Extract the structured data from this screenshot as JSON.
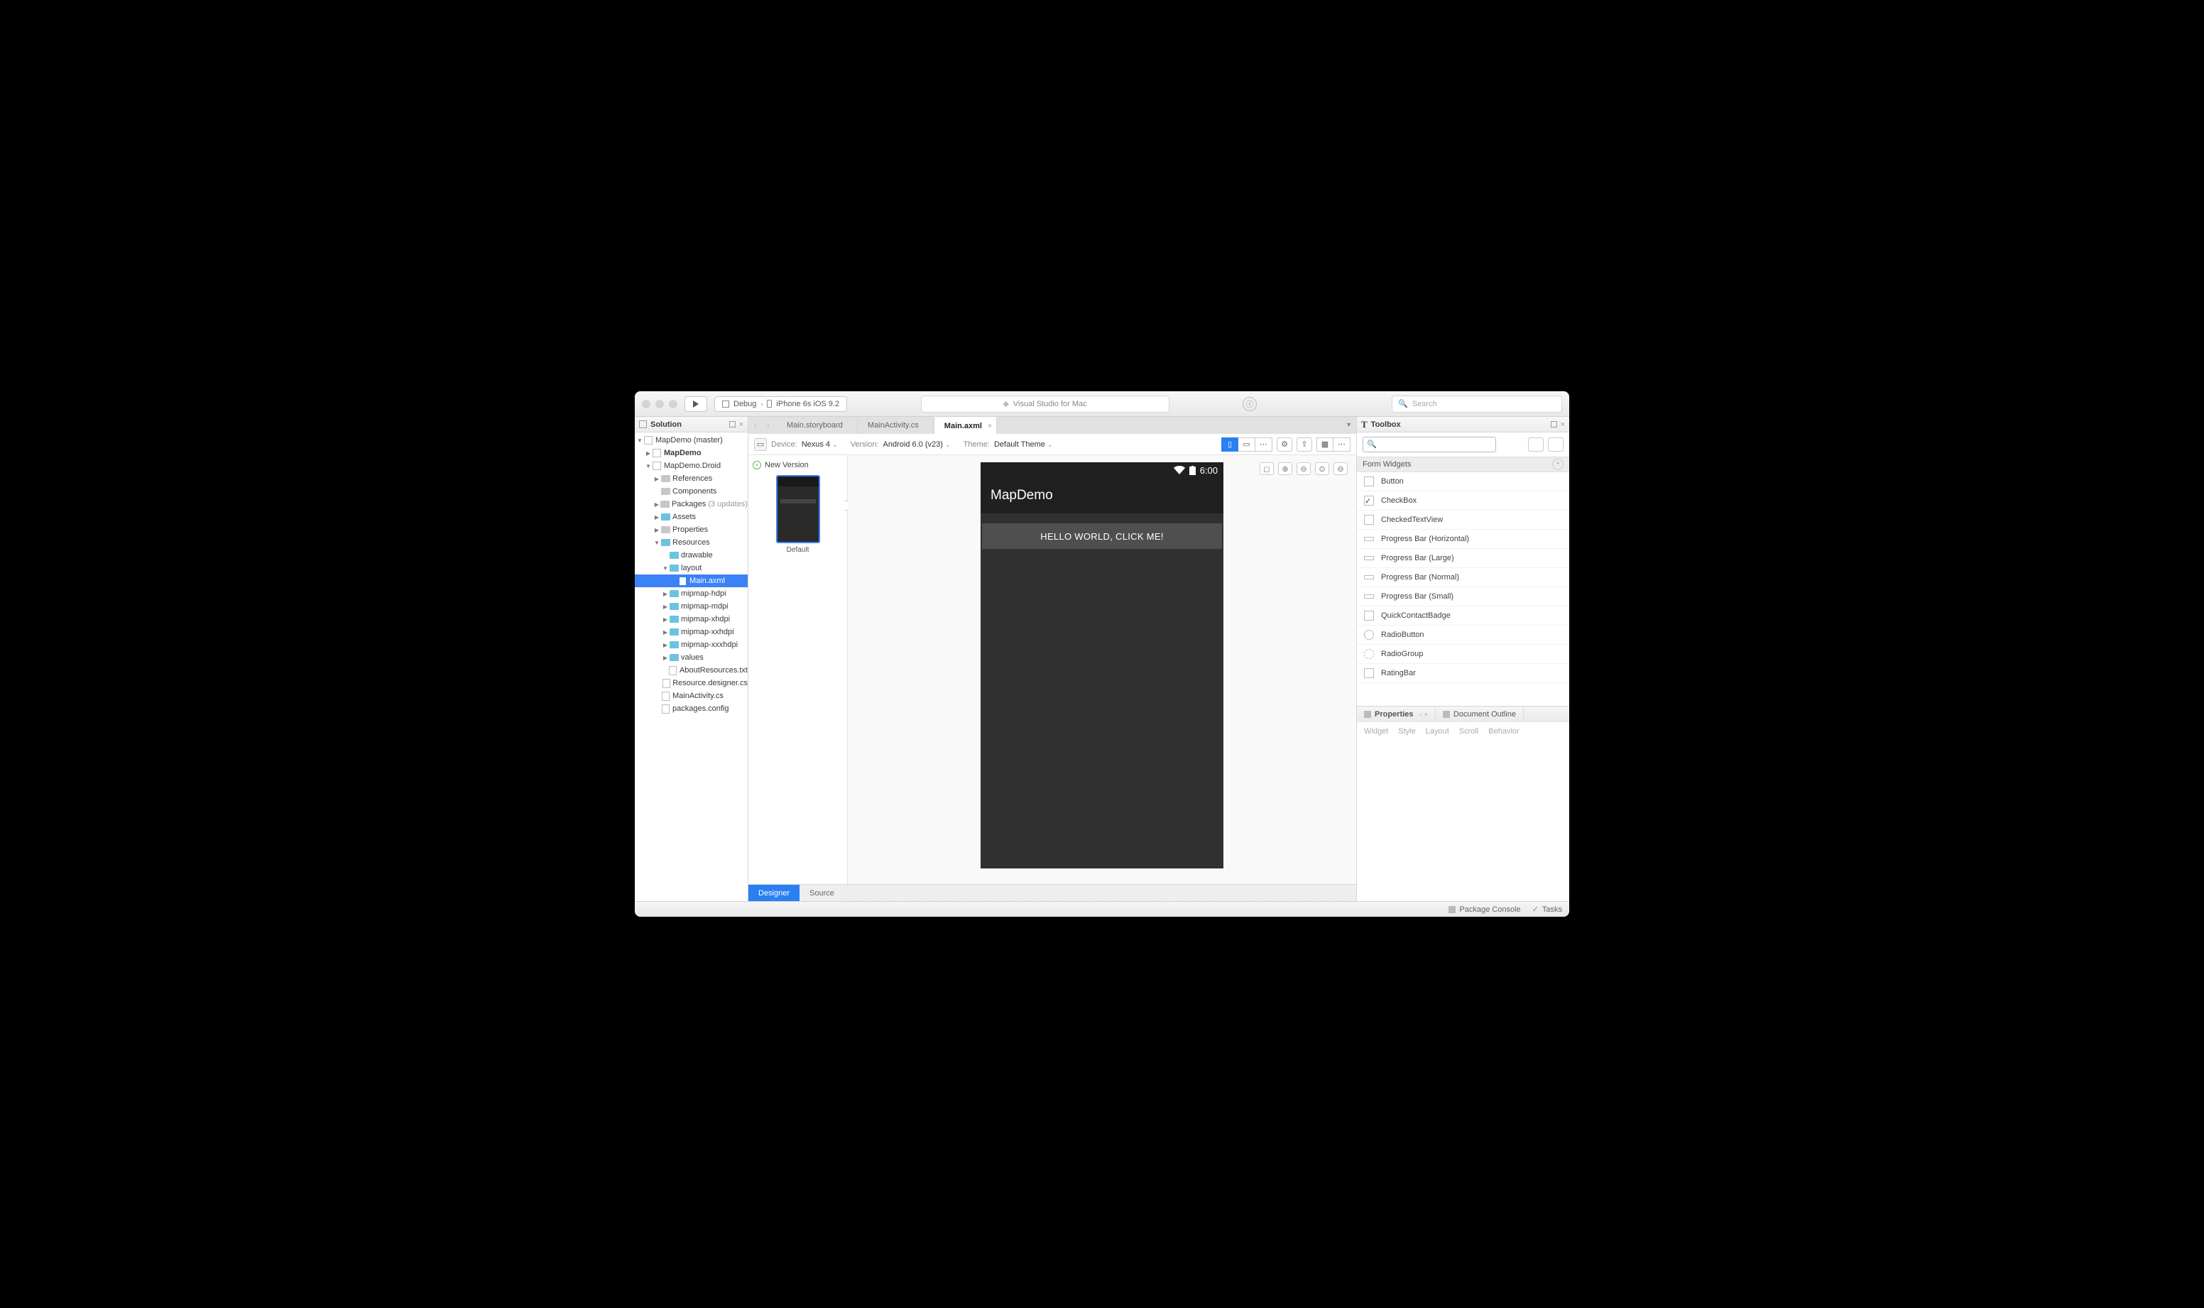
{
  "titlebar": {
    "config": "Debug",
    "target": "iPhone 6s iOS 9.2",
    "app_title": "Visual Studio for Mac",
    "search_placeholder": "Search"
  },
  "solution": {
    "title": "Solution",
    "tree": {
      "root": "MapDemo (master)",
      "proj1": "MapDemo",
      "proj2": "MapDemo.Droid",
      "references": "References",
      "components": "Components",
      "packages": "Packages",
      "packages_note": "(3 updates)",
      "assets": "Assets",
      "properties": "Properties",
      "resources": "Resources",
      "drawable": "drawable",
      "layout": "layout",
      "mainaxml": "Main.axml",
      "mip_h": "mipmap-hdpi",
      "mip_m": "mipmap-mdpi",
      "mip_xh": "mipmap-xhdpi",
      "mip_xxh": "mipmap-xxhdpi",
      "mip_xxxh": "mipmap-xxxhdpi",
      "values": "values",
      "about": "AboutResources.txt",
      "resdes": "Resource.designer.cs",
      "mainact": "MainActivity.cs",
      "pkgcfg": "packages.config"
    }
  },
  "tabs": {
    "t1": "Main.storyboard",
    "t2": "MainActivity.cs",
    "t3": "Main.axml"
  },
  "designer_toolbar": {
    "device_lbl": "Device:",
    "device_val": "Nexus 4",
    "version_lbl": "Version:",
    "version_val": "Android 6.0 (v23)",
    "theme_lbl": "Theme:",
    "theme_val": "Default Theme"
  },
  "thumb": {
    "new_version": "New Version",
    "default": "Default"
  },
  "phone": {
    "time": "6:00",
    "title": "MapDemo",
    "button": "HELLO WORLD, CLICK ME!"
  },
  "designer_footer": {
    "designer": "Designer",
    "source": "Source"
  },
  "toolbox": {
    "title": "Toolbox",
    "category": "Form Widgets",
    "items": [
      "Button",
      "CheckBox",
      "CheckedTextView",
      "Progress Bar (Horizontal)",
      "Progress Bar (Large)",
      "Progress Bar (Normal)",
      "Progress Bar (Small)",
      "QuickContactBadge",
      "RadioButton",
      "RadioGroup",
      "RatingBar"
    ]
  },
  "properties": {
    "tab_props": "Properties",
    "tab_outline": "Document Outline",
    "subtabs": [
      "Widget",
      "Style",
      "Layout",
      "Scroll",
      "Behavior"
    ]
  },
  "statusbar": {
    "pkg": "Package Console",
    "tasks": "Tasks"
  }
}
